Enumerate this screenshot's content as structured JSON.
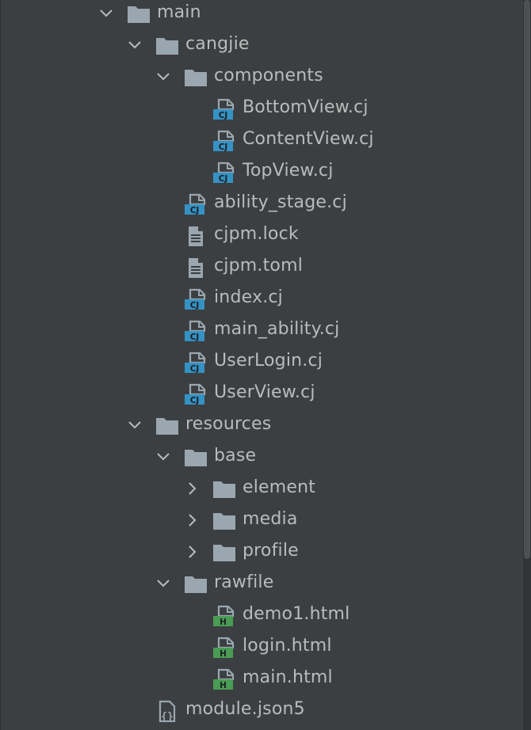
{
  "colors": {
    "background": "#3c3f41",
    "text": "#bbbbbb",
    "folder": "#9aa7b0",
    "cangjie_badge": "#3592c4",
    "html_badge": "#499c54",
    "file_doc": "#9aa7b0"
  },
  "icon_text": {
    "cj": "CJ",
    "h": "H",
    "json": "{}"
  },
  "tree": [
    {
      "label": "main",
      "depth": 0,
      "type": "folder",
      "chevron": "expanded"
    },
    {
      "label": "cangjie",
      "depth": 1,
      "type": "folder",
      "chevron": "expanded"
    },
    {
      "label": "components",
      "depth": 2,
      "type": "folder",
      "chevron": "expanded"
    },
    {
      "label": "BottomView.cj",
      "depth": 3,
      "type": "cj",
      "chevron": "none"
    },
    {
      "label": "ContentView.cj",
      "depth": 3,
      "type": "cj",
      "chevron": "none"
    },
    {
      "label": "TopView.cj",
      "depth": 3,
      "type": "cj",
      "chevron": "none"
    },
    {
      "label": "ability_stage.cj",
      "depth": 2,
      "type": "cj",
      "chevron": "none"
    },
    {
      "label": "cjpm.lock",
      "depth": 2,
      "type": "text",
      "chevron": "none"
    },
    {
      "label": "cjpm.toml",
      "depth": 2,
      "type": "text",
      "chevron": "none"
    },
    {
      "label": "index.cj",
      "depth": 2,
      "type": "cj",
      "chevron": "none"
    },
    {
      "label": "main_ability.cj",
      "depth": 2,
      "type": "cj",
      "chevron": "none"
    },
    {
      "label": "UserLogin.cj",
      "depth": 2,
      "type": "cj",
      "chevron": "none"
    },
    {
      "label": "UserView.cj",
      "depth": 2,
      "type": "cj",
      "chevron": "none"
    },
    {
      "label": "resources",
      "depth": 1,
      "type": "folder",
      "chevron": "expanded"
    },
    {
      "label": "base",
      "depth": 2,
      "type": "folder",
      "chevron": "expanded"
    },
    {
      "label": "element",
      "depth": 3,
      "type": "folder",
      "chevron": "collapsed"
    },
    {
      "label": "media",
      "depth": 3,
      "type": "folder",
      "chevron": "collapsed"
    },
    {
      "label": "profile",
      "depth": 3,
      "type": "folder",
      "chevron": "collapsed"
    },
    {
      "label": "rawfile",
      "depth": 2,
      "type": "folder",
      "chevron": "expanded"
    },
    {
      "label": "demo1.html",
      "depth": 3,
      "type": "html",
      "chevron": "none"
    },
    {
      "label": "login.html",
      "depth": 3,
      "type": "html",
      "chevron": "none"
    },
    {
      "label": "main.html",
      "depth": 3,
      "type": "html",
      "chevron": "none"
    },
    {
      "label": "module.json5",
      "depth": 1,
      "type": "json",
      "chevron": "none"
    }
  ]
}
